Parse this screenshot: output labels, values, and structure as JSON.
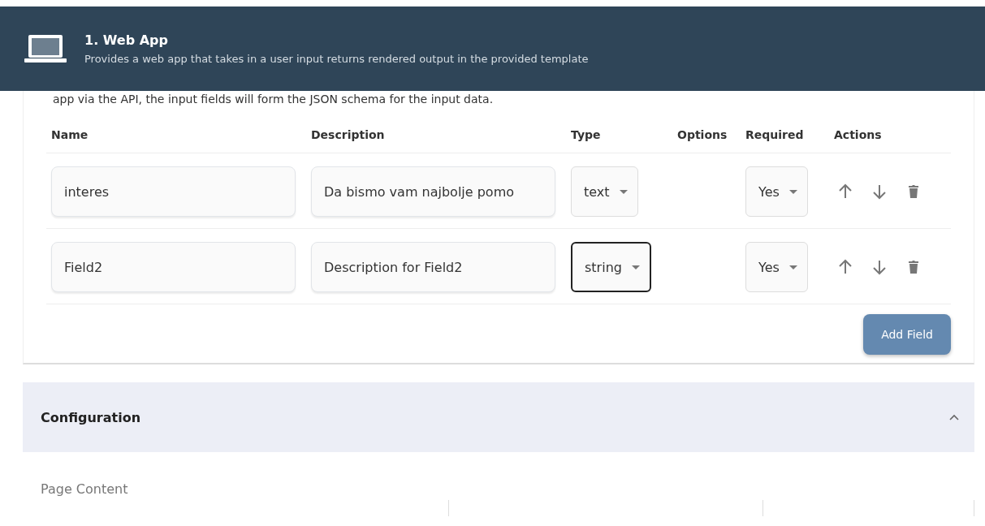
{
  "header": {
    "title": "1. Web App",
    "subtitle": "Provides a web app that takes in a user input returns rendered output in the provided template"
  },
  "intro": "app via the API, the input fields will form the JSON schema for the input data.",
  "table": {
    "columns": [
      "Name",
      "Description",
      "Type",
      "Options",
      "Required",
      "Actions"
    ],
    "rows": [
      {
        "name": "interes",
        "description": "Da bismo vam najbolje pomo",
        "type": {
          "value": "text",
          "focused": false
        },
        "required": {
          "value": "Yes",
          "focused": false
        }
      },
      {
        "name": "Field2",
        "description": "Description for Field2",
        "type": {
          "value": "string",
          "focused": true
        },
        "required": {
          "value": "Yes",
          "focused": false
        }
      }
    ]
  },
  "add_button": "Add Field",
  "configuration": {
    "title": "Configuration",
    "expanded": true,
    "label": "Page Content"
  }
}
